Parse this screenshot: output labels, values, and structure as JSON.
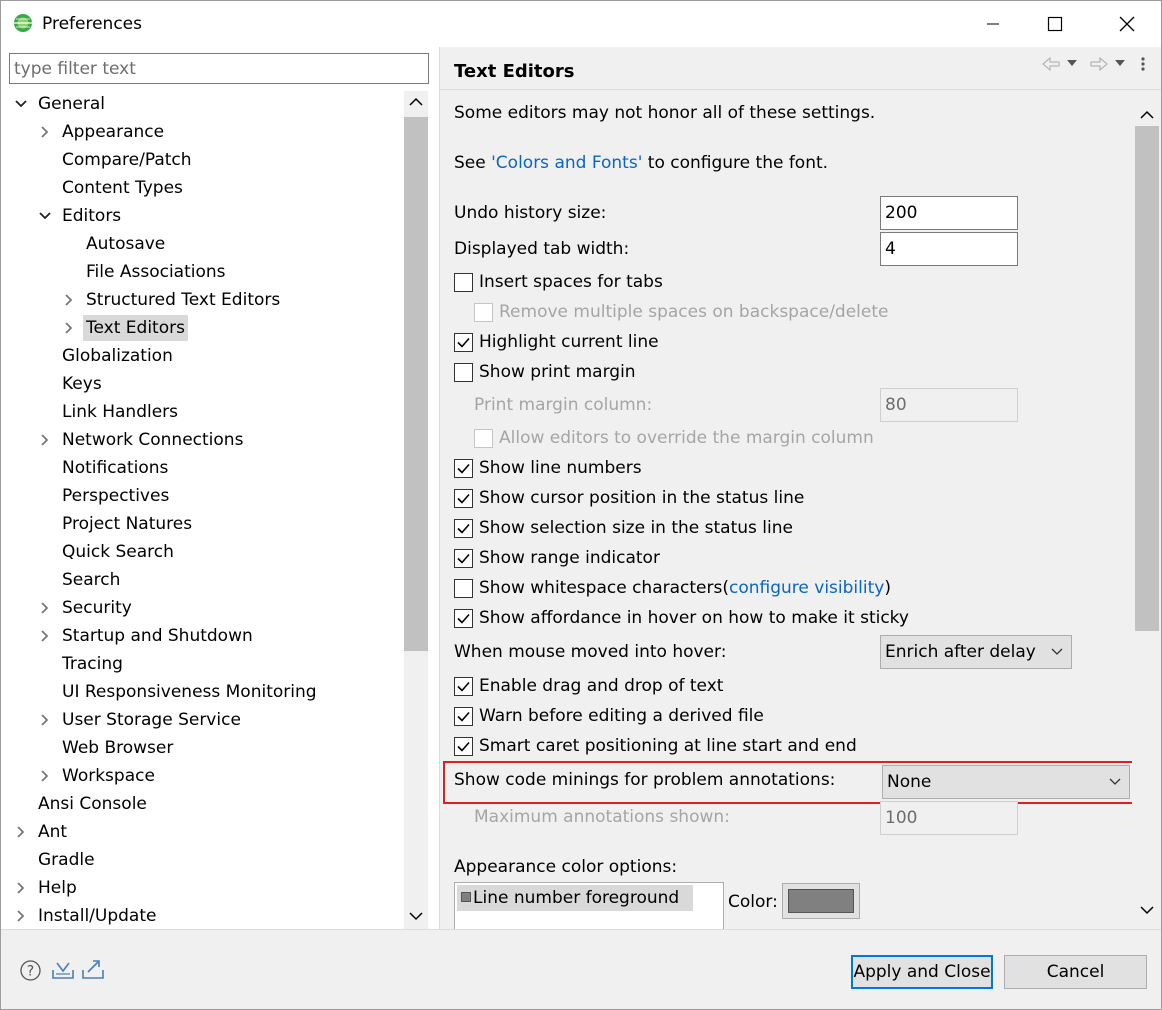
{
  "window": {
    "title": "Preferences"
  },
  "filter": {
    "placeholder": "type filter text"
  },
  "tree": [
    {
      "label": "General",
      "level": 0,
      "twisty": "open"
    },
    {
      "label": "Appearance",
      "level": 1,
      "twisty": "closed"
    },
    {
      "label": "Compare/Patch",
      "level": 1,
      "twisty": "none"
    },
    {
      "label": "Content Types",
      "level": 1,
      "twisty": "none"
    },
    {
      "label": "Editors",
      "level": 1,
      "twisty": "open"
    },
    {
      "label": "Autosave",
      "level": 2,
      "twisty": "none"
    },
    {
      "label": "File Associations",
      "level": 2,
      "twisty": "none"
    },
    {
      "label": "Structured Text Editors",
      "level": 2,
      "twisty": "closed"
    },
    {
      "label": "Text Editors",
      "level": 2,
      "twisty": "closed",
      "selected": true
    },
    {
      "label": "Globalization",
      "level": 1,
      "twisty": "none"
    },
    {
      "label": "Keys",
      "level": 1,
      "twisty": "none"
    },
    {
      "label": "Link Handlers",
      "level": 1,
      "twisty": "none"
    },
    {
      "label": "Network Connections",
      "level": 1,
      "twisty": "closed"
    },
    {
      "label": "Notifications",
      "level": 1,
      "twisty": "none"
    },
    {
      "label": "Perspectives",
      "level": 1,
      "twisty": "none"
    },
    {
      "label": "Project Natures",
      "level": 1,
      "twisty": "none"
    },
    {
      "label": "Quick Search",
      "level": 1,
      "twisty": "none"
    },
    {
      "label": "Search",
      "level": 1,
      "twisty": "none"
    },
    {
      "label": "Security",
      "level": 1,
      "twisty": "closed"
    },
    {
      "label": "Startup and Shutdown",
      "level": 1,
      "twisty": "closed"
    },
    {
      "label": "Tracing",
      "level": 1,
      "twisty": "none"
    },
    {
      "label": "UI Responsiveness Monitoring",
      "level": 1,
      "twisty": "none"
    },
    {
      "label": "User Storage Service",
      "level": 1,
      "twisty": "closed"
    },
    {
      "label": "Web Browser",
      "level": 1,
      "twisty": "none"
    },
    {
      "label": "Workspace",
      "level": 1,
      "twisty": "closed"
    },
    {
      "label": "Ansi Console",
      "level": 0,
      "twisty": "none"
    },
    {
      "label": "Ant",
      "level": 0,
      "twisty": "closed"
    },
    {
      "label": "Gradle",
      "level": 0,
      "twisty": "none"
    },
    {
      "label": "Help",
      "level": 0,
      "twisty": "closed"
    },
    {
      "label": "Install/Update",
      "level": 0,
      "twisty": "closed"
    }
  ],
  "page": {
    "title": "Text Editors",
    "intro": "Some editors may not honor all of these settings.",
    "see_prefix": "See ",
    "see_link": "'Colors and Fonts'",
    "see_suffix": " to configure the font.",
    "undo_label": "Undo history size:",
    "undo_value": "200",
    "tab_label": "Displayed tab width:",
    "tab_value": "4",
    "insert_spaces": "Insert spaces for tabs",
    "remove_spaces": "Remove multiple spaces on backspace/delete",
    "highlight_line": "Highlight current line",
    "show_print_margin": "Show print margin",
    "print_margin_label": "Print margin column:",
    "print_margin_value": "80",
    "allow_override": "Allow editors to override the margin column",
    "line_numbers": "Show line numbers",
    "cursor_pos": "Show cursor position in the status line",
    "selection_size": "Show selection size in the status line",
    "range_indicator": "Show range indicator",
    "whitespace": "Show whitespace characters",
    "whitespace_open": "(",
    "whitespace_link": "configure visibility",
    "whitespace_close": ")",
    "affordance": "Show affordance in hover on how to make it sticky",
    "hover_label": "When mouse moved into hover:",
    "hover_value": "Enrich after delay",
    "drag_drop": "Enable drag and drop of text",
    "warn_derived": "Warn before editing a derived file",
    "smart_caret": "Smart caret positioning at line start and end",
    "minings_label": "Show code minings for problem annotations:",
    "minings_value": "None",
    "max_annotations_label": "Maximum annotations shown:",
    "max_annotations_value": "100",
    "appearance_label": "Appearance color options:",
    "color_list_item": "Line number foreground",
    "color_label": "Color:"
  },
  "colors": {
    "swatch": "#808080",
    "accent": "#0078d7",
    "link": "#0b65c2",
    "highlight": "#e02020"
  },
  "buttons": {
    "apply_close": "Apply and Close",
    "cancel": "Cancel"
  }
}
